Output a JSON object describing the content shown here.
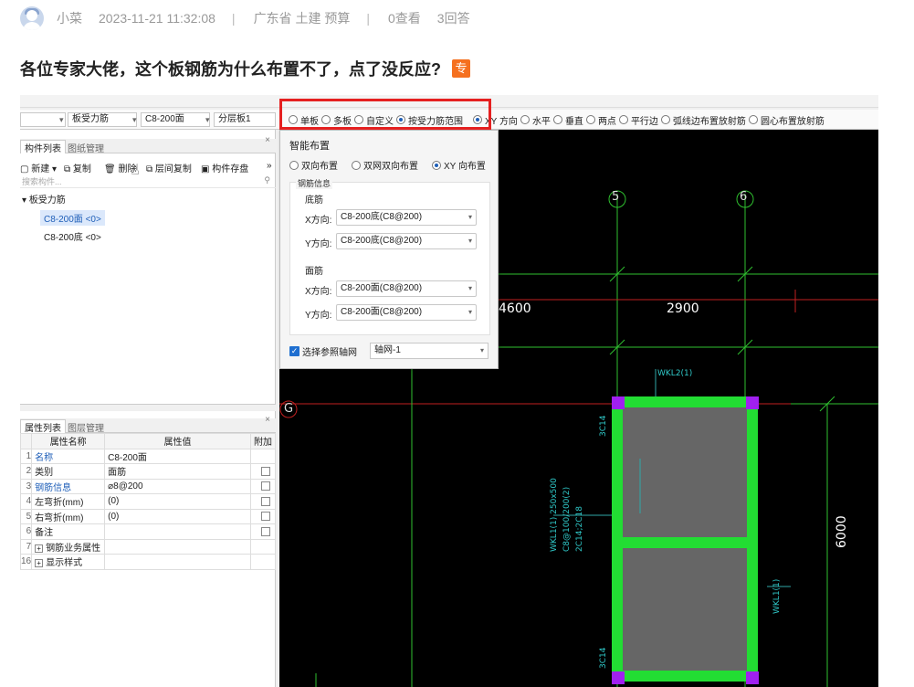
{
  "post": {
    "author": "小菜",
    "datetime": "2023-11-21 11:32:08",
    "sep": "|",
    "tags": "广东省  土建 预算",
    "views": "0查看",
    "answers": "3回答",
    "title": "各位专家大佬，这个板钢筋为什么布置不了，点了没反应?",
    "badge": "专"
  },
  "toolbar": {
    "select_type": "板受力筋",
    "select_component": "C8-200面",
    "select_layer": "分层板1",
    "radios": [
      "单板",
      "多板",
      "自定义",
      "按受力筋范围",
      "XY 方向",
      "水平",
      "垂直",
      "两点",
      "平行边",
      "弧线边布置放射筋",
      "圆心布置放射筋"
    ],
    "selected_radio": "按受力筋范围"
  },
  "component_panel": {
    "tab_active": "构件列表",
    "tab_other": "图纸管理",
    "tools": [
      "新建",
      "复制",
      "删除",
      "层间复制",
      "构件存盘"
    ],
    "search_placeholder": "搜索构件...",
    "tree_root": "板受力筋",
    "items": [
      "C8-200面 <0>",
      "C8-200底 <0>"
    ]
  },
  "property_panel": {
    "tab_active": "属性列表",
    "tab_other": "图层管理",
    "headers": [
      "属性名称",
      "属性值",
      "附加"
    ],
    "rows": [
      {
        "num": "1",
        "name": "名称",
        "value": "C8-200面"
      },
      {
        "num": "2",
        "name": "类别",
        "value": "面筋"
      },
      {
        "num": "3",
        "name": "钢筋信息",
        "value": "⌀8@200"
      },
      {
        "num": "4",
        "name": "左弯折(mm)",
        "value": "(0)"
      },
      {
        "num": "5",
        "name": "右弯折(mm)",
        "value": "(0)"
      },
      {
        "num": "6",
        "name": "备注",
        "value": ""
      },
      {
        "num": "7",
        "name": "钢筋业务属性",
        "value": ""
      },
      {
        "num": "16",
        "name": "显示样式",
        "value": ""
      }
    ]
  },
  "smart_layout": {
    "title": "智能布置",
    "options": [
      "双向布置",
      "双网双向布置",
      "XY 向布置"
    ],
    "selected": "XY 向布置",
    "group_label": "钢筋信息",
    "bottom_label": "底筋",
    "top_label": "面筋",
    "x_label": "X方向:",
    "y_label": "Y方向:",
    "bottom_x": "C8-200底(C8@200)",
    "bottom_y": "C8-200底(C8@200)",
    "top_x": "C8-200面(C8@200)",
    "top_y": "C8-200面(C8@200)",
    "axis_checkbox": "选择参照轴网",
    "axis_value": "轴网-1"
  },
  "cad": {
    "axis_5": "5",
    "axis_6": "6",
    "axis_g": "G",
    "dim_4600": "4600",
    "dim_2900": "2900",
    "dim_6000": "6000",
    "beam_top": "WKL2(1)",
    "beam_left": "WKL1(1) 250x500",
    "beam_left2": "C8@100/200(2)",
    "beam_left3": "2C14;2C18",
    "beam_right": "WKL1(1)",
    "col_tag": "3C14",
    "col_tag2": "3C14"
  },
  "colors": {
    "red_highlight": "#e52020",
    "beam_green": "#22dd33",
    "column_purple": "#a020f0",
    "cad_bg": "#000000"
  }
}
